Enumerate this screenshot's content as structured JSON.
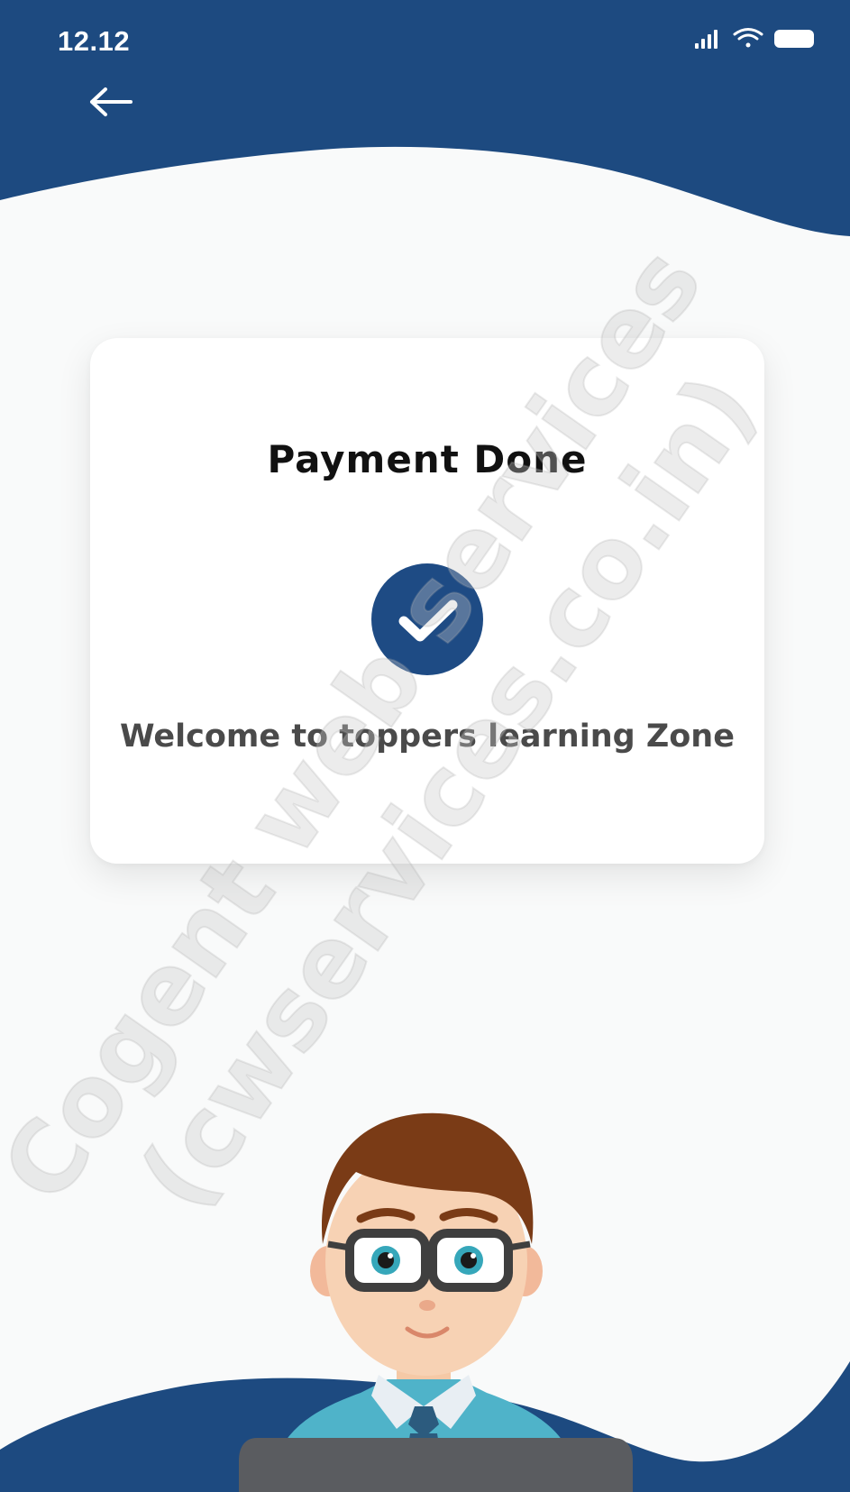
{
  "status_bar": {
    "time": "12.12",
    "signal_icon": "cellular-signal-icon",
    "wifi_icon": "wifi-icon",
    "battery_icon": "battery-icon"
  },
  "nav": {
    "back_icon": "arrow-left-icon"
  },
  "card": {
    "title": "Payment Done",
    "status_icon": "check-circle-icon",
    "message": "Welcome to toppers learning Zone"
  },
  "watermark": {
    "line1": "Cogent web services",
    "line2": "(cwservices.co.in)"
  },
  "colors": {
    "brand_blue": "#1e4b84",
    "header_blue": "#1d4a80",
    "background": "#f9fafa",
    "card_bg": "#ffffff",
    "title_text": "#111111",
    "message_text": "#4a4a4a"
  }
}
